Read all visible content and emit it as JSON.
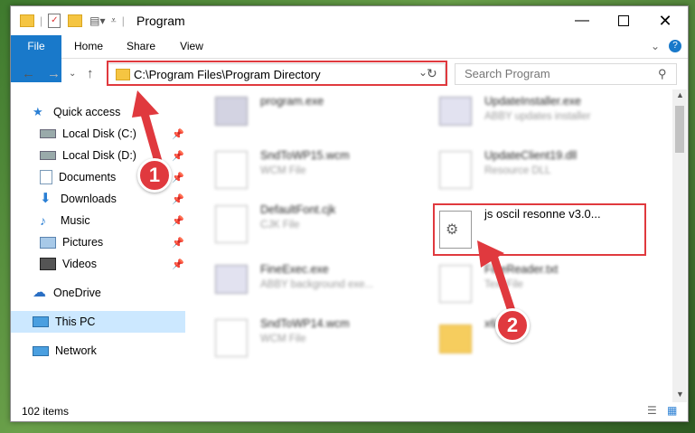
{
  "window": {
    "title": "Program"
  },
  "ribbon": {
    "tabs": [
      "File",
      "Home",
      "Share",
      "View"
    ]
  },
  "address": {
    "path": "C:\\Program Files\\Program Directory",
    "search_placeholder": "Search Program"
  },
  "sidebar": {
    "items": [
      {
        "label": "Quick access"
      },
      {
        "label": "Local Disk (C:)"
      },
      {
        "label": "Local Disk (D:)"
      },
      {
        "label": "Documents"
      },
      {
        "label": "Downloads"
      },
      {
        "label": "Music"
      },
      {
        "label": "Pictures"
      },
      {
        "label": "Videos"
      },
      {
        "label": "OneDrive"
      },
      {
        "label": "This PC"
      },
      {
        "label": "Network"
      }
    ]
  },
  "files": [
    {
      "name": "program.exe",
      "type": ""
    },
    {
      "name": "UpdateInstaller.exe",
      "type": "ABBY updates installer"
    },
    {
      "name": "SndToWP15.wcm",
      "type": "WCM File"
    },
    {
      "name": "UpdateClient19.dll",
      "type": "Resource DLL"
    },
    {
      "name": "DefaultFont.cjk",
      "type": "CJK File"
    },
    {
      "name": "js oscil resonne v3.0...",
      "type": ""
    },
    {
      "name": "FineExec.exe",
      "type": "ABBY background exe..."
    },
    {
      "name": "FineReader.txt",
      "type": "Text File"
    },
    {
      "name": "SndToWP14.wcm",
      "type": "WCM File"
    },
    {
      "name": "x64",
      "type": ""
    }
  ],
  "status": {
    "count": "102 items"
  },
  "annotations": {
    "step1": "1",
    "step2": "2"
  },
  "colors": {
    "accent": "#1979ca",
    "highlight": "#e0393e",
    "selected": "#cce8ff"
  }
}
